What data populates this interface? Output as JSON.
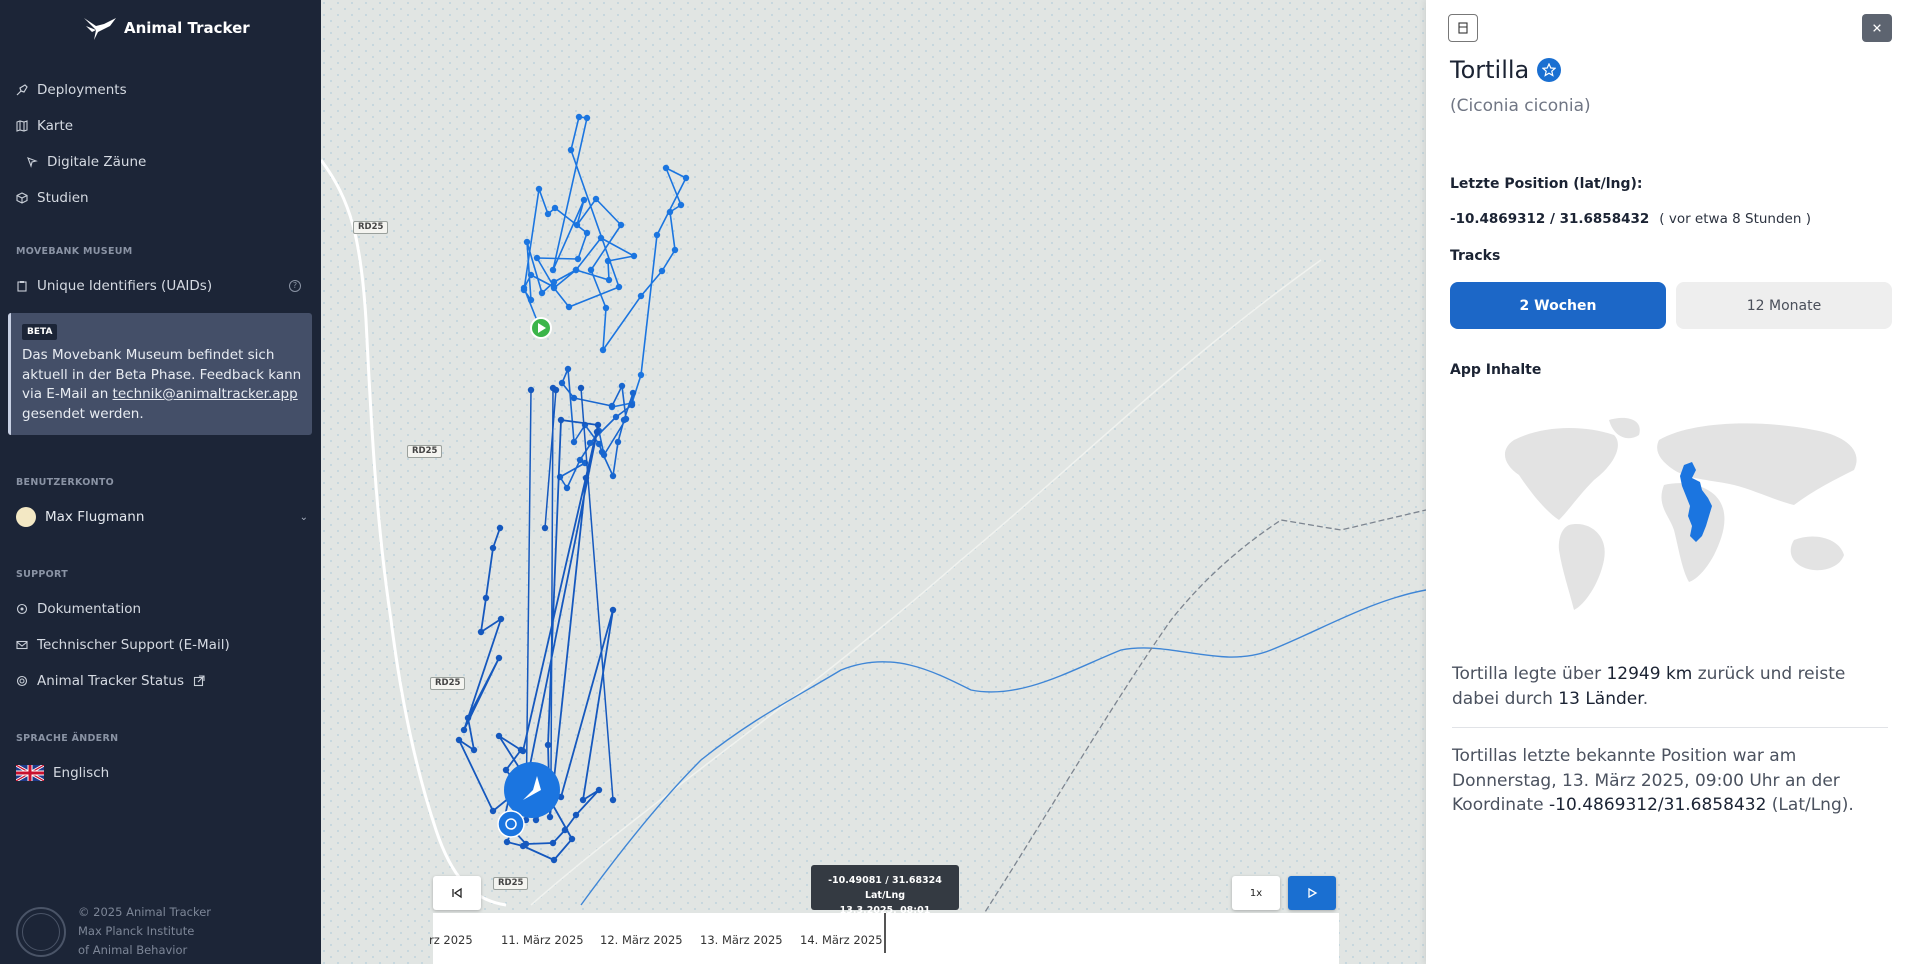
{
  "app": {
    "name": "Animal Tracker"
  },
  "sidebar": {
    "nav": [
      {
        "label": "Deployments",
        "icon": "deployment-icon"
      },
      {
        "label": "Karte",
        "icon": "map-icon"
      },
      {
        "label": "Digitale Zäune",
        "icon": "fence-icon"
      },
      {
        "label": "Studien",
        "icon": "studies-icon"
      }
    ],
    "museum_section": "MOVEBANK MUSEUM",
    "uaid_label": "Unique Identifiers (UAIDs)",
    "beta": {
      "badge": "BETA",
      "text_before": "Das Movebank Museum befindet sich aktuell in der Beta Phase. Feedback kann via E-Mail an ",
      "email": "technik@animaltracker.app",
      "text_after": " gesendet werden."
    },
    "account_section": "BENUTZERKONTO",
    "user_name": "Max Flugmann",
    "support_section": "SUPPORT",
    "support": [
      {
        "label": "Dokumentation",
        "icon": "docs-icon"
      },
      {
        "label": "Technischer Support (E-Mail)",
        "icon": "mail-icon"
      },
      {
        "label": "Animal Tracker Status",
        "icon": "status-icon"
      }
    ],
    "language_section": "SPRACHE ÄNDERN",
    "language": "Englisch",
    "footer": {
      "line1": "© 2025 Animal Tracker",
      "line2": "Max Planck Institute",
      "line3": "of Animal Behavior"
    }
  },
  "map": {
    "road_label": "RD25",
    "tooltip_coords": "-10.49081 / 31.68324 Lat/Lng",
    "tooltip_time": "13.3.2025, 08:01",
    "speed": "1x",
    "timeline": [
      "rz 2025",
      "11. März 2025",
      "12. März 2025",
      "13. März 2025",
      "14. März 2025"
    ]
  },
  "panel": {
    "name": "Tortilla",
    "latin": "(Ciconia ciconia)",
    "last_pos_label": "Letzte Position (lat/lng):",
    "coords": "-10.4869312 / 31.6858432",
    "ago": "( vor etwa 8 Stunden )",
    "tracks_label": "Tracks",
    "tracks": [
      "2 Wochen",
      "12 Monate"
    ],
    "app_content_label": "App Inhalte",
    "summary": {
      "prefix": "Tortilla legte über ",
      "distance": "12949 km",
      "middle": " zurück und reiste dabei durch ",
      "countries": "13 Länder",
      "suffix": "."
    },
    "lastpos": {
      "prefix": "Tortillas letzte bekannte Position war am Donnerstag, 13. März 2025, 09:00 Uhr an der Koordinate ",
      "coords": "-10.4869312/31.6858432",
      "suffix": " (Lat/Lng)."
    }
  },
  "colors": {
    "sidebar_bg": "#1c2537",
    "accent": "#1a6fd1",
    "track": "#1b75e0"
  }
}
